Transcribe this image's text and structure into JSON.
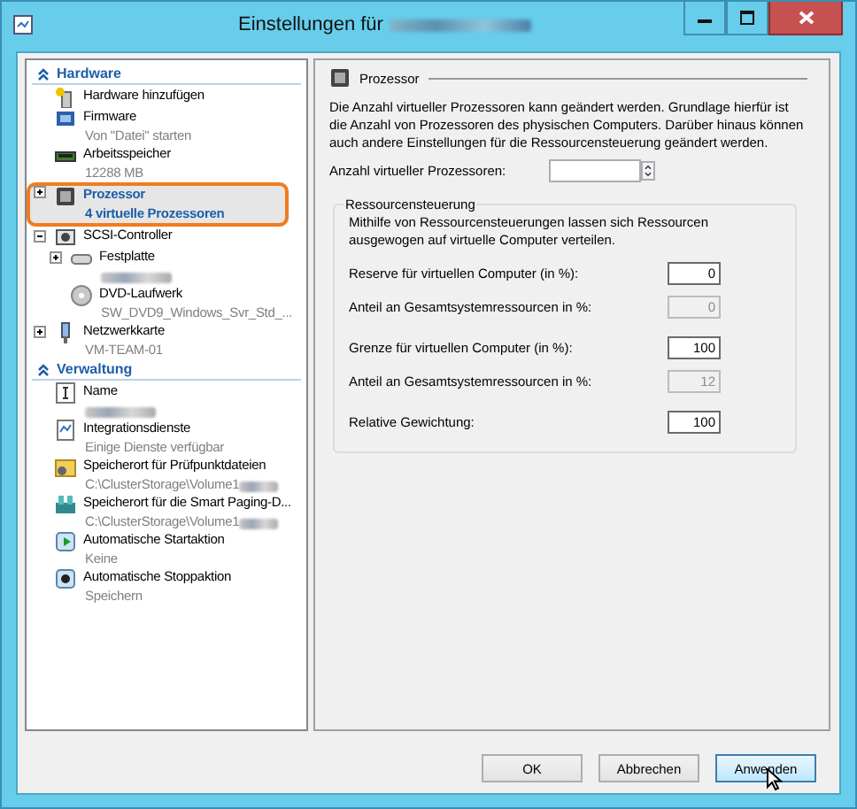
{
  "window": {
    "title": "Einstellungen für",
    "title_redacted": true
  },
  "sidebar": {
    "sections": [
      {
        "title": "Hardware",
        "expanded": true,
        "items": [
          {
            "kind": "add-hardware",
            "label": "Hardware hinzufügen",
            "selected": false
          },
          {
            "kind": "firmware",
            "label": "Firmware",
            "sublabel": "Von \"Datei\" starten",
            "selected": false
          },
          {
            "kind": "memory",
            "label": "Arbeitsspeicher",
            "sublabel": "12288 MB",
            "selected": false
          },
          {
            "kind": "processor",
            "label": "Prozessor",
            "sublabel": "4 virtuelle Prozessoren",
            "selected": true,
            "expanded": false
          },
          {
            "kind": "controller",
            "label": "SCSI-Controller",
            "selected": false,
            "expanded": true,
            "children": [
              {
                "kind": "disk",
                "label": "Festplatte",
                "sublabel_redacted": true,
                "selected": false,
                "expanded": false
              },
              {
                "kind": "dvd",
                "label": "DVD-Laufwerk",
                "sublabel": "SW_DVD9_Windows_Svr_Std_...",
                "selected": false
              }
            ]
          },
          {
            "kind": "network",
            "label": "Netzwerkkarte",
            "sublabel": "VM-TEAM-01",
            "selected": false,
            "expanded": false
          }
        ]
      },
      {
        "title": "Verwaltung",
        "expanded": true,
        "items": [
          {
            "kind": "name",
            "label": "Name",
            "sublabel_redacted": true,
            "selected": false
          },
          {
            "kind": "integration",
            "label": "Integrationsdienste",
            "sublabel": "Einige Dienste verfügbar",
            "selected": false
          },
          {
            "kind": "checkpoint",
            "label": "Speicherort für Prüfpunktdateien",
            "sublabel": "C:\\ClusterStorage\\Volume1",
            "sublabel_redacted": true,
            "selected": false
          },
          {
            "kind": "paging",
            "label": "Speicherort für die Smart Paging-D...",
            "sublabel": "C:\\ClusterStorage\\Volume1",
            "sublabel_redacted": true,
            "selected": false
          },
          {
            "kind": "start",
            "label": "Automatische Startaktion",
            "sublabel": "Keine",
            "selected": false
          },
          {
            "kind": "stop",
            "label": "Automatische Stoppaktion",
            "sublabel": "Speichern",
            "selected": false
          }
        ]
      }
    ]
  },
  "pane": {
    "title": "Prozessor",
    "description": "Die Anzahl virtueller Prozessoren kann geändert werden. Grundlage hierfür ist die Anzahl von Prozessoren des physischen Computers. Darüber hinaus können auch andere Einstellungen für die Ressourcensteuerung geändert werden.",
    "count_field": {
      "label": "Anzahl virtueller Prozessoren:"
    },
    "resource_control": {
      "title": "Ressourcensteuerung",
      "description": "Mithilfe von Ressourcensteuerungen lassen sich Ressourcen ausgewogen auf virtuelle Computer verteilen.",
      "row_groups": [
        [
          {
            "label": "Reserve für virtuellen Computer (in %):",
            "value": "0",
            "disabled": false
          },
          {
            "label": "Anteil an Gesamtsystemressourcen in %:",
            "value": "0",
            "disabled": true
          }
        ],
        [
          {
            "label": "Grenze für virtuellen Computer (in %):",
            "value": "100",
            "disabled": false
          },
          {
            "label": "Anteil an Gesamtsystemressourcen in %:",
            "value": "12",
            "disabled": true
          }
        ],
        [
          {
            "label": "Relative Gewichtung:",
            "value": "100",
            "disabled": false
          }
        ]
      ]
    }
  },
  "buttons": [
    {
      "label": "OK",
      "hovered": false
    },
    {
      "label": "Abbrechen",
      "hovered": false
    },
    {
      "label": "Anwenden",
      "hovered": true
    }
  ]
}
